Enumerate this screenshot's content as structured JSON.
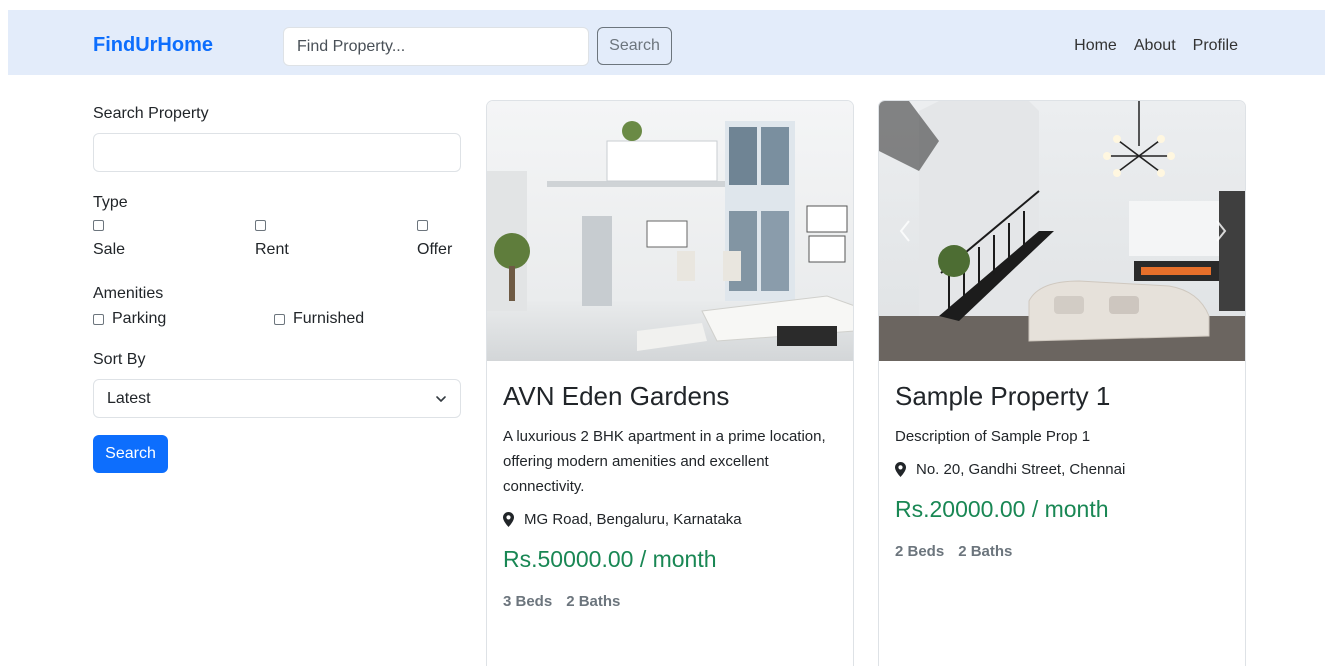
{
  "navbar": {
    "brand": "FindUrHome",
    "search_placeholder": "Find Property...",
    "search_button": "Search",
    "links": [
      "Home",
      "About",
      "Profile"
    ]
  },
  "sidebar": {
    "search_label": "Search Property",
    "search_value": "",
    "type_label": "Type",
    "types": [
      {
        "label": "Sale",
        "checked": false
      },
      {
        "label": "Rent",
        "checked": false
      },
      {
        "label": "Offer",
        "checked": false
      }
    ],
    "amenities_label": "Amenities",
    "amenities": [
      {
        "label": "Parking",
        "checked": false
      },
      {
        "label": "Furnished",
        "checked": false
      }
    ],
    "sort_label": "Sort By",
    "sort_selected": "Latest",
    "search_button": "Search"
  },
  "listings": [
    {
      "title": "AVN Eden Gardens",
      "description": "A luxurious 2 BHK apartment in a prime location, offering modern amenities and excellent connectivity.",
      "location": "MG Road, Bengaluru, Karnataka",
      "price": "Rs.50000.00 / month",
      "beds": "3 Beds",
      "baths": "2 Baths"
    },
    {
      "title": "Sample Property 1",
      "description": "Description of Sample Prop 1",
      "location": "No. 20, Gandhi Street, Chennai",
      "price": "Rs.20000.00 / month",
      "beds": "2 Beds",
      "baths": "2 Baths"
    }
  ],
  "colors": {
    "brand": "#0d6efd",
    "navbar_bg": "#e3ecfa",
    "price": "#198754",
    "muted": "#6c757d"
  }
}
